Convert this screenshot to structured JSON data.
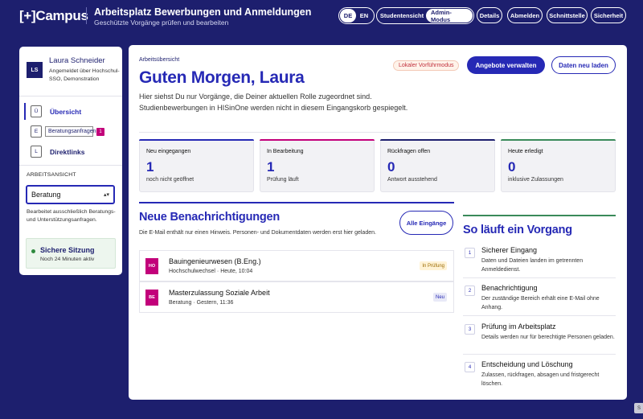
{
  "brand": {
    "logo": "[+]Campus"
  },
  "header": {
    "title": "Arbeitsplatz Bewerbungen und Anmeldungen",
    "subtitle": "Geschützte Vorgänge prüfen und bearbeiten"
  },
  "topnav": {
    "lang": [
      "DE",
      "EN"
    ],
    "lang_active": "DE",
    "modes": [
      "Studentensicht",
      "Admin-Modus"
    ],
    "mode_active": "Admin-Modus",
    "buttons": [
      "Details",
      "Abmelden",
      "Schnittstelle",
      "Sicherheit"
    ]
  },
  "sidebar": {
    "avatar": "LS",
    "name": "Laura Schneider",
    "desc": "Angemeldet über Hochschul-SSO, Demonstration",
    "items": [
      {
        "key": "Ü",
        "label": "Übersicht"
      },
      {
        "key": "E",
        "label": "Beratungsanfragen",
        "badge": "1"
      },
      {
        "key": "L",
        "label": "Direktlinks"
      }
    ],
    "view_label": "ARBEITSANSICHT",
    "view_value": "Beratung",
    "view_hint": "Bearbeitet ausschließlich Beratungs- und Unterstützungsanfragen.",
    "session_title": "Sichere Sitzung",
    "session_sub": "Noch 24 Minuten aktiv"
  },
  "main": {
    "crumb": "Arbeitsübersicht",
    "greeting": "Guten Morgen, Laura",
    "intro": "Hier siehst Du nur Vorgänge, die Deiner aktuellen Rolle zugeordnet sind. Studienbewerbungen in HISinOne werden nicht in diesem Eingangskorb gespiegelt.",
    "demo_badge": "Lokaler Vorführmodus",
    "btn_manage": "Angebote verwalten",
    "btn_reload": "Daten neu laden",
    "kpis": [
      {
        "title": "Neu eingegangen",
        "value": "1",
        "sub": "noch nicht geöffnet",
        "color": "#2629b5"
      },
      {
        "title": "In Bearbeitung",
        "value": "1",
        "sub": "Prüfung läuft",
        "color": "#c2007a"
      },
      {
        "title": "Rückfragen offen",
        "value": "0",
        "sub": "Antwort ausstehend",
        "color": "#1d1f6e"
      },
      {
        "title": "Heute erledigt",
        "value": "0",
        "sub": "inklusive Zulassungen",
        "color": "#3a8a5a"
      }
    ],
    "notifications": {
      "title": "Neue Benachrichtigungen",
      "sub": "Die E-Mail enthält nur einen Hinweis. Personen- und Dokumentdaten werden erst hier geladen.",
      "btn_all": "Alle Eingänge",
      "items": [
        {
          "icon": "HO",
          "title": "Bauingenieurwesen (B.Eng.)",
          "sub": "Hochschulwechsel · Heute, 10:04",
          "status": "In Prüfung",
          "status_color": "#fff3d6",
          "status_text": "#9a6a00"
        },
        {
          "icon": "BE",
          "title": "Masterzulassung Soziale Arbeit",
          "sub": "Beratung · Gestern, 11:36",
          "status": "Neu",
          "status_color": "#e8e9f7",
          "status_text": "#2629b5"
        }
      ]
    },
    "process": {
      "title": "So läuft ein Vorgang",
      "steps": [
        {
          "n": "1",
          "title": "Sicherer Eingang",
          "desc": "Daten und Dateien landen im getrennten Anmeldedienst."
        },
        {
          "n": "2",
          "title": "Benachrichtigung",
          "desc": "Der zuständige Bereich erhält eine E-Mail ohne Anhang."
        },
        {
          "n": "3",
          "title": "Prüfung im Arbeitsplatz",
          "desc": "Details werden nur für berechtigte Personen geladen."
        },
        {
          "n": "4",
          "title": "Entscheidung und Löschung",
          "desc": "Zulassen, rückfragen, absagen und fristgerecht löschen."
        }
      ]
    }
  },
  "corner": "S"
}
